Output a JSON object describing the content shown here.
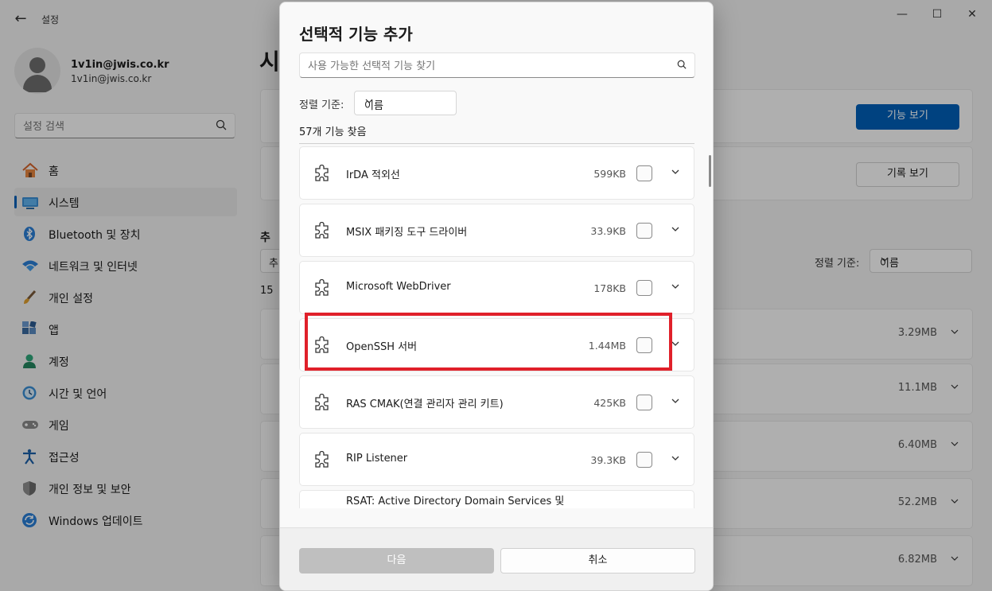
{
  "window": {
    "app_title": "설정",
    "back_glyph": "←",
    "minimize_glyph": "—",
    "maximize_glyph": "☐",
    "close_glyph": "✕"
  },
  "user": {
    "name": "1v1in@jwis.co.kr",
    "email": "1v1in@jwis.co.kr"
  },
  "sidebar": {
    "search_placeholder": "설정 검색",
    "items": [
      {
        "label": "홈",
        "icon": "home-icon"
      },
      {
        "label": "시스템",
        "icon": "system-icon",
        "active": true
      },
      {
        "label": "Bluetooth 및 장치",
        "icon": "bluetooth-icon"
      },
      {
        "label": "네트워크 및 인터넷",
        "icon": "wifi-icon"
      },
      {
        "label": "개인 설정",
        "icon": "brush-icon"
      },
      {
        "label": "앱",
        "icon": "apps-icon"
      },
      {
        "label": "계정",
        "icon": "account-icon"
      },
      {
        "label": "시간 및 언어",
        "icon": "clock-icon"
      },
      {
        "label": "게임",
        "icon": "gamepad-icon"
      },
      {
        "label": "접근성",
        "icon": "accessibility-icon"
      },
      {
        "label": "개인 정보 및 보안",
        "icon": "shield-icon"
      },
      {
        "label": "Windows 업데이트",
        "icon": "update-icon"
      }
    ]
  },
  "background": {
    "page_title": "시",
    "view_features_label": "기능 보기",
    "view_history_label": "기록 보기",
    "section_fragment": "추",
    "filter_fragment": "추",
    "count_fragment": "15",
    "sort_label": "정렬 기준:",
    "sort_value": "이름",
    "row_sizes": [
      "3.29MB",
      "11.1MB",
      "6.40MB",
      "52.2MB",
      "6.82MB"
    ]
  },
  "dialog": {
    "title": "선택적 기능 추가",
    "search_placeholder": "사용 가능한 선택적 기능 찾기",
    "sort_label": "정렬 기준:",
    "sort_value": "이름",
    "count_text": "57개 기능 찾음",
    "features": [
      {
        "name": "IrDA 적외선",
        "size": "599KB",
        "checked": false
      },
      {
        "name": "MSIX 패키징 도구 드라이버",
        "size": "33.9KB",
        "checked": false
      },
      {
        "name": "Microsoft WebDriver",
        "size": "178KB",
        "checked": false
      },
      {
        "name": "OpenSSH 서버",
        "size": "1.44MB",
        "checked": false,
        "highlighted": true
      },
      {
        "name": "RAS CMAK(연결 관리자 관리 키트)",
        "size": "425KB",
        "checked": false
      },
      {
        "name": "RIP Listener",
        "size": "39.3KB",
        "checked": false
      },
      {
        "name": "RSAT: Active Directory Domain Services 및",
        "size": "",
        "checked": false
      }
    ],
    "next_label": "다음",
    "cancel_label": "취소"
  },
  "colors": {
    "accent": "#005fb8",
    "highlight_border": "#e0202a",
    "disabled_button": "#bfbfbf"
  }
}
